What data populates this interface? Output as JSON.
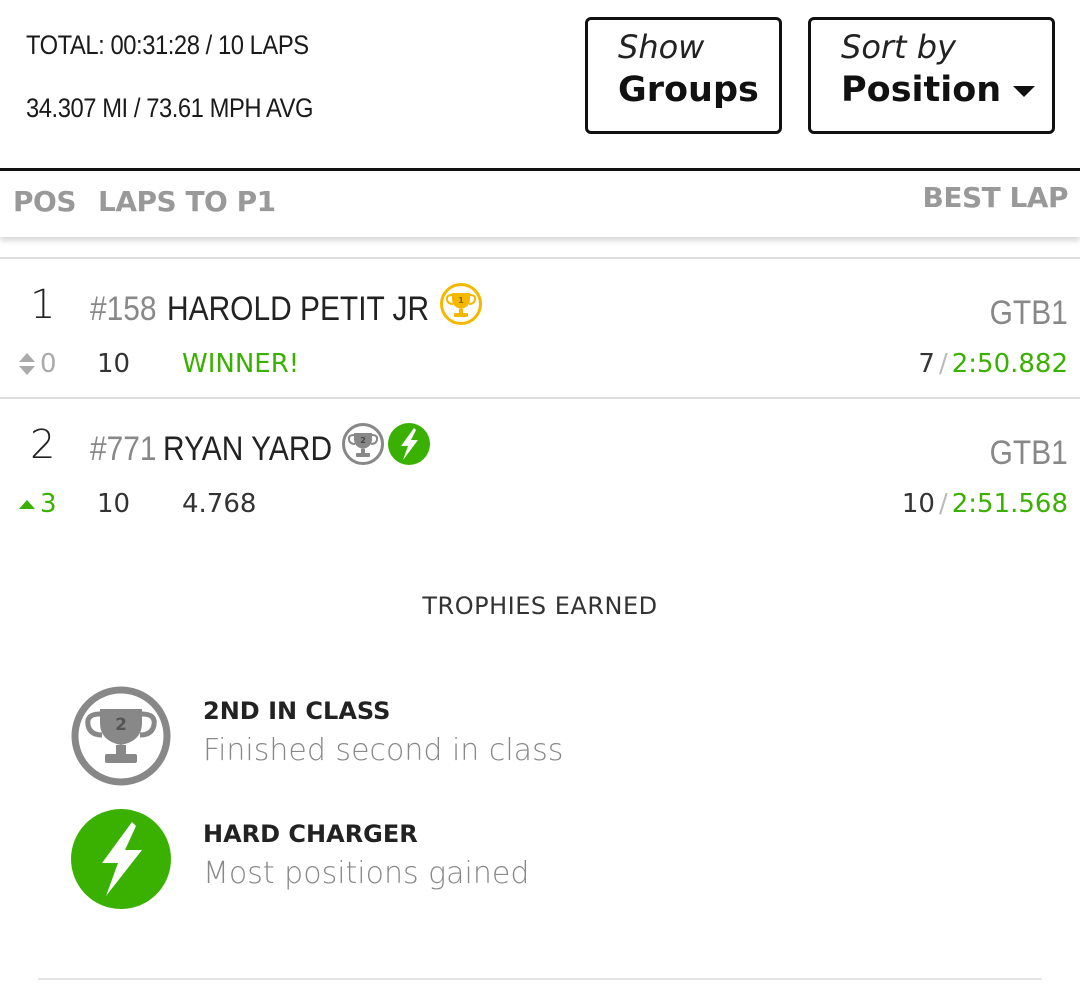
{
  "summary": {
    "total": "TOTAL: 00:31:28 / 10 LAPS",
    "distance": "34.307 MI / 73.61 MPH AVG"
  },
  "controls": {
    "groups": {
      "small": "Show",
      "big": "Groups"
    },
    "sort": {
      "small": "Sort by",
      "big": "Position"
    }
  },
  "table_header": {
    "pos": "POS",
    "laps_to_p1": "LAPS TO P1",
    "best_lap": "BEST LAP"
  },
  "rows": [
    {
      "pos": "1",
      "car": "#158",
      "driver": "HAROLD PETIT JR",
      "class": "GTB1",
      "change": "0",
      "change_dir": "none",
      "laps": "10",
      "gap": "WINNER!",
      "best_lap_no": "7",
      "best_lap_time": "2:50.882",
      "icons": [
        "trophy-1st-icon"
      ]
    },
    {
      "pos": "2",
      "car": "#771",
      "driver": "RYAN YARD",
      "class": "GTB1",
      "change": "3",
      "change_dir": "up",
      "laps": "10",
      "gap": "4.768",
      "best_lap_no": "10",
      "best_lap_time": "2:51.568",
      "icons": [
        "trophy-2nd-icon",
        "hard-charger-icon"
      ]
    }
  ],
  "trophies": {
    "title": "TROPHIES EARNED",
    "items": [
      {
        "name": "2ND IN CLASS",
        "desc": "Finished second in class",
        "icon": "trophy-2nd-icon"
      },
      {
        "name": "HARD CHARGER",
        "desc": "Most positions gained",
        "icon": "hard-charger-icon"
      }
    ]
  },
  "colors": {
    "accent_green": "#3ab000",
    "gold": "#f5b800",
    "silver": "#888888"
  }
}
